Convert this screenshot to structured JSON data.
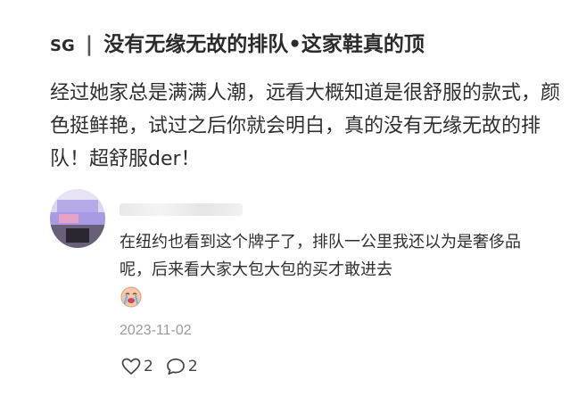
{
  "post": {
    "tag": "SG",
    "separator": "|",
    "title": "没有无缘无故的排队•这家鞋真的顶",
    "body": "经过她家总是满满人潮，远看大概知道是很舒服的款式，颜色挺鲜艳，试过之后你就会明白，真的没有无缘无故的排队！超舒服der！"
  },
  "comment": {
    "text": "在纽约也看到这个牌子了，排队一公里我还以为是奢侈品呢，后来看大家大包大包的买才敢进去",
    "emoji_icon": "crying-face-emoji-icon",
    "date": "2023-11-02",
    "like_count": "2",
    "reply_count": "2"
  },
  "colors": {
    "text": "#2f2f2f",
    "muted": "#9a9a9a"
  }
}
